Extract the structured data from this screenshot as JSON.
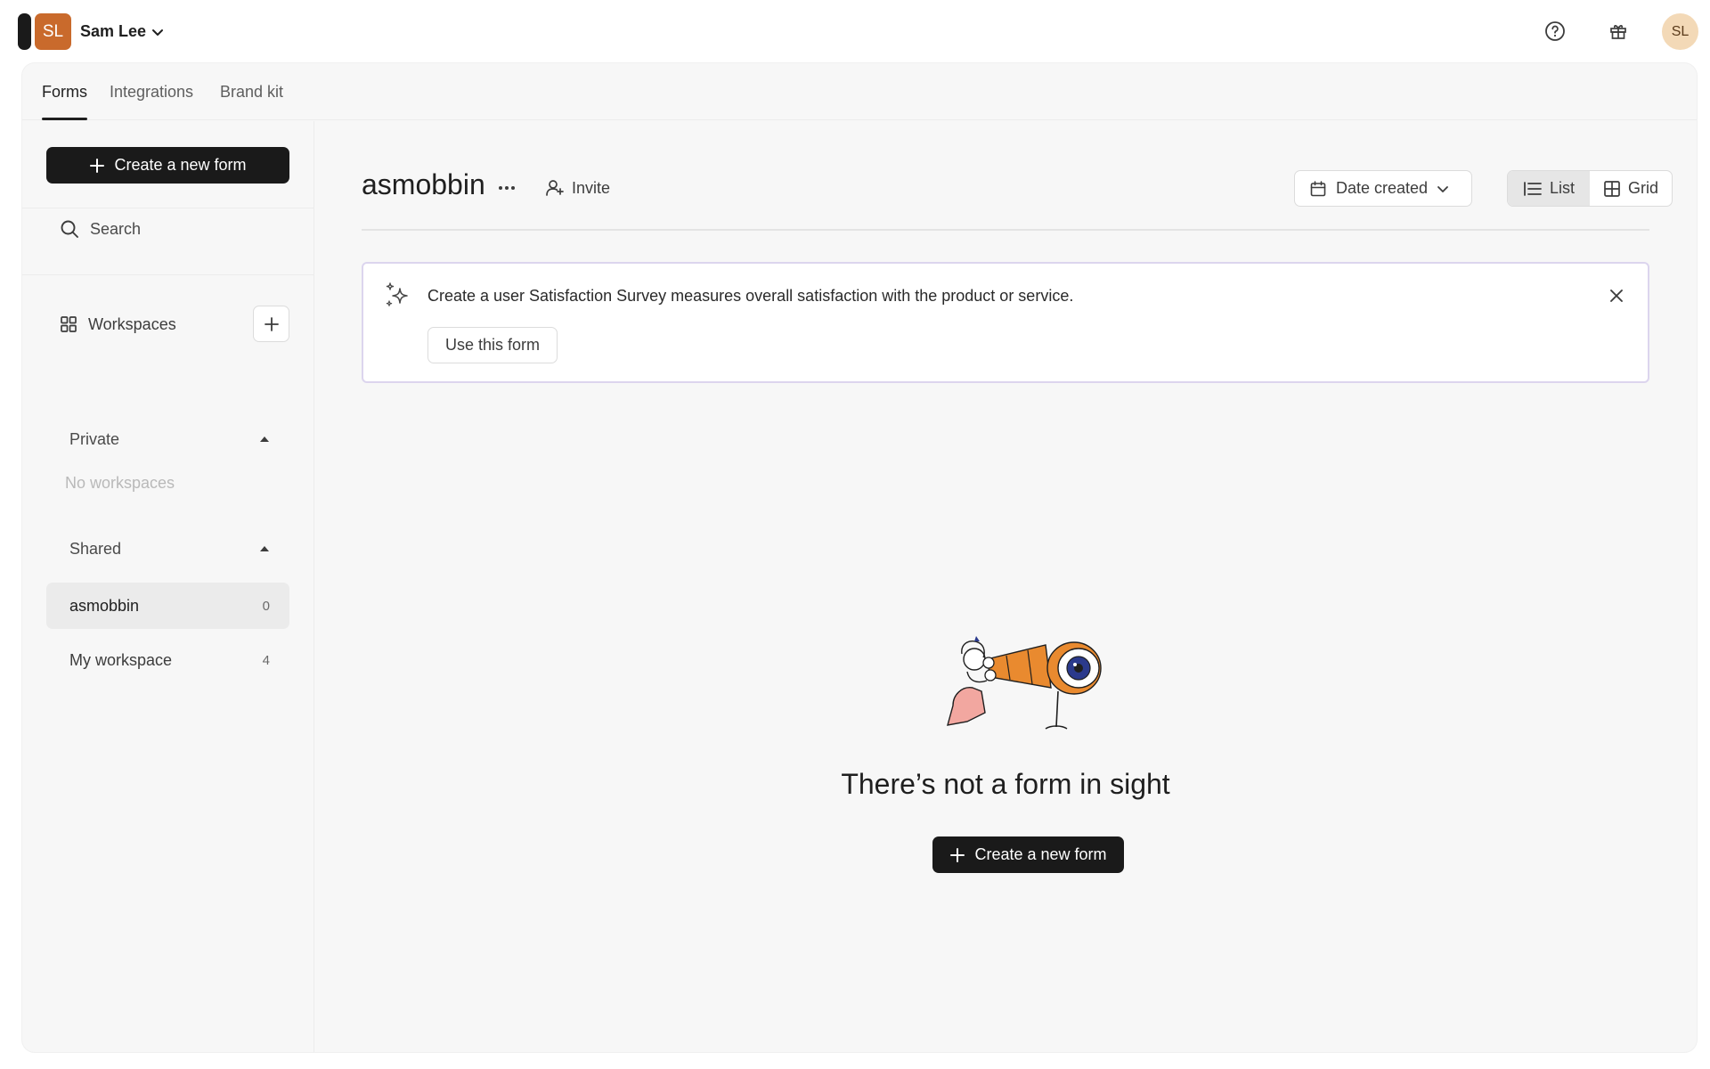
{
  "account": {
    "initials": "SL",
    "name": "Sam Lee",
    "avatar_color": "#c96a2c"
  },
  "header": {
    "icons": [
      "help-icon",
      "gift-icon"
    ],
    "user_initials": "SL",
    "user_avatar_color": "#f3d9b7"
  },
  "tabs": [
    {
      "label": "Forms",
      "active": true
    },
    {
      "label": "Integrations",
      "active": false
    },
    {
      "label": "Brand kit",
      "active": false
    }
  ],
  "sidebar": {
    "create_label": "Create a new form",
    "search_label": "Search",
    "workspaces_label": "Workspaces",
    "groups": {
      "private_label": "Private",
      "private_empty": "No workspaces",
      "shared_label": "Shared"
    },
    "workspaces": [
      {
        "name": "asmobbin",
        "count": "0",
        "active": true
      },
      {
        "name": "My workspace",
        "count": "4",
        "active": false
      }
    ]
  },
  "main": {
    "workspace_title": "asmobbin",
    "more_label": "···",
    "invite_label": "Invite",
    "sort_label": "Date created",
    "view_options": [
      {
        "label": "List",
        "active": true
      },
      {
        "label": "Grid",
        "active": false
      }
    ],
    "suggestion": {
      "text": "Create a user Satisfaction Survey measures overall satisfaction with the product or service.",
      "button_label": "Use this form",
      "border_color": "#dcd5ee"
    },
    "empty_state": {
      "title": "There’s not a form in sight",
      "create_label": "Create a new form"
    }
  },
  "colors": {
    "primary_button": "#1a1a1a",
    "card_background": "#f7f7f7"
  }
}
